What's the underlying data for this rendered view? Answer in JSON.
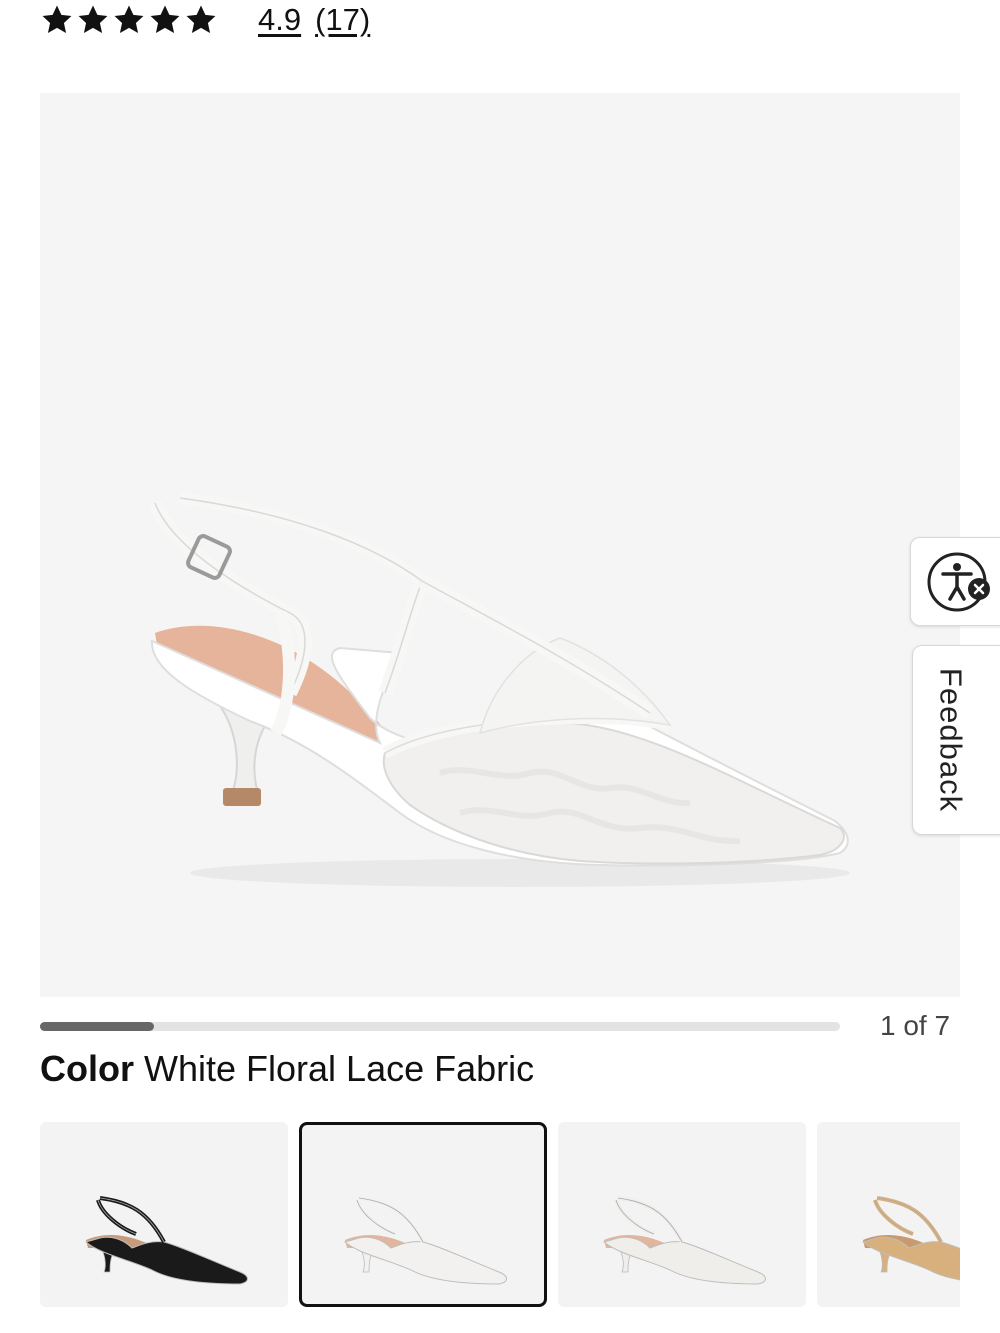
{
  "rating": {
    "stars_filled": 5,
    "stars_total": 5,
    "value": "4.9",
    "count": "(17)"
  },
  "gallery": {
    "current": 1,
    "total": 7,
    "counter_text": "1 of 7",
    "image_alt": "White floral lace slingback kitten heel"
  },
  "side_buttons": {
    "accessibility_icon": "accessibility-icon",
    "feedback_label": "Feedback"
  },
  "color": {
    "label": "Color",
    "value": "White Floral Lace Fabric"
  },
  "swatches": [
    {
      "name": "black",
      "shoe_color": "#1a1a1a",
      "lining": "#c89a7a",
      "selected": false
    },
    {
      "name": "white-floral-lace",
      "shoe_color": "#f2f1ef",
      "lining": "#e0b79c",
      "selected": true
    },
    {
      "name": "white",
      "shoe_color": "#efeeea",
      "lining": "#e0b79c",
      "selected": false
    },
    {
      "name": "natural",
      "shoe_color": "#d8b07e",
      "lining": "#c99a6d",
      "selected": false
    }
  ],
  "colors": {
    "accent": "#111111",
    "hero_bg": "#f5f5f5",
    "progress_fill": "#676767",
    "progress_track": "#e3e3e3"
  }
}
